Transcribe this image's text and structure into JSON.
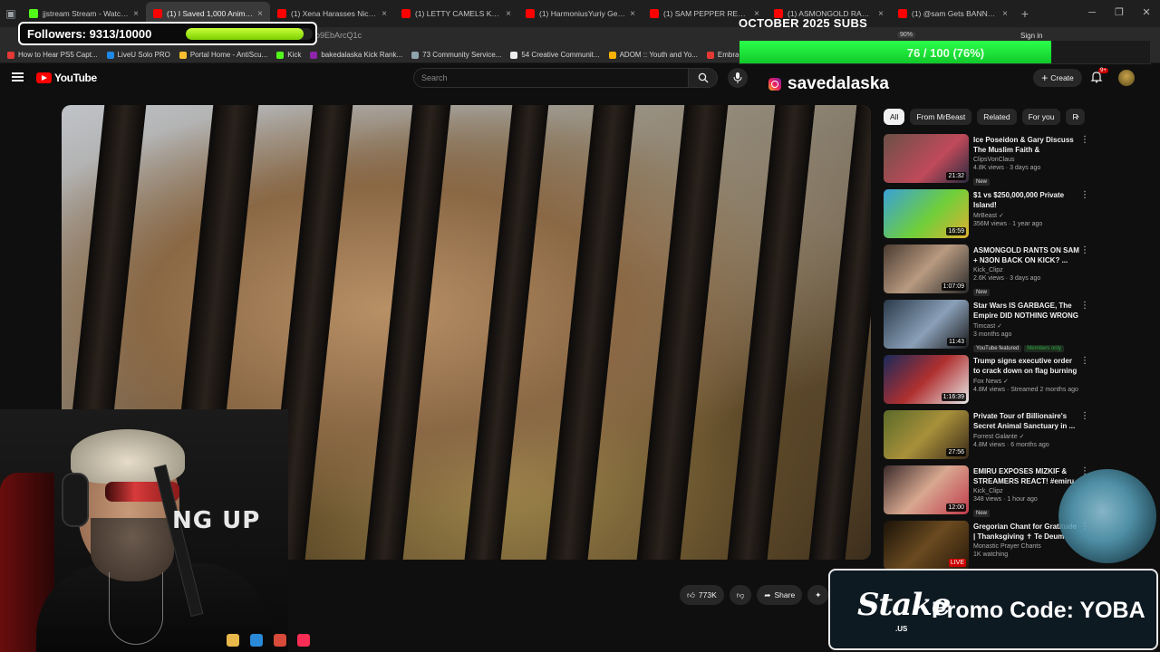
{
  "browser": {
    "tabs": [
      {
        "title": "jjstream Stream - Watch Live o",
        "color": "#53fc18",
        "active": false
      },
      {
        "title": "(1) I Saved 1,000 Animals",
        "color": "#ff0000",
        "active": true
      },
      {
        "title": "(1) Xena Harasses Nick Wi",
        "color": "#ff0000",
        "active": false
      },
      {
        "title": "(1) LETTY CAMELS KENYA WIT",
        "color": "#ff0000",
        "active": false
      },
      {
        "title": "(1) HarmoniusYuriy Gets A",
        "color": "#ff0000",
        "active": false
      },
      {
        "title": "(1) SAM PEPPER RETURNS",
        "color": "#ff0000",
        "active": false
      },
      {
        "title": "(1) ASMONGOLD RANTS",
        "color": "#ff0000",
        "active": false
      },
      {
        "title": "(1) @sam Gets BANNED on Ki",
        "color": "#ff0000",
        "active": false
      }
    ],
    "url_fragment": "o9EbArcQ1c",
    "zoom": "90%",
    "sign_in": "Sign in",
    "bookmarks": [
      {
        "label": "How to Hear PS5 Capt...",
        "color": "#e53935"
      },
      {
        "label": "LiveU Solo PRO",
        "color": "#1e88e5"
      },
      {
        "label": "Portal Home - AntiScu...",
        "color": "#fbc02d"
      },
      {
        "label": "Kick",
        "color": "#53fc18"
      },
      {
        "label": "bakedalaska Kick Rank...",
        "color": "#8e24aa"
      },
      {
        "label": "73 Community Service...",
        "color": "#90a4ae"
      },
      {
        "label": "54 Creative Communit...",
        "color": "#eeeeee"
      },
      {
        "label": "ADOM :: Youth and Yo...",
        "color": "#ffb300"
      },
      {
        "label": "Embracing the Cross a...",
        "color": "#e53935"
      }
    ]
  },
  "youtube": {
    "logo_text": "YouTube",
    "search_placeholder": "Search",
    "create_label": "Create",
    "notification_count": "9+",
    "video": {
      "overlay_caption": "NG UP"
    },
    "actions": {
      "likes": "773K",
      "share": "Share"
    },
    "chips": [
      "All",
      "From MrBeast",
      "Related",
      "For you",
      "R"
    ],
    "recommendations": [
      {
        "title": "Ice Poseidon & Gary Discuss The Muslim Faith & Immigration",
        "channel": "ClipsVonClaus",
        "meta": "4.8K views · 3 days ago",
        "badge": "New",
        "duration": "21:32",
        "thumb": "linear-gradient(135deg,#6b5046,#c04a5a 60%,#2a2a40)"
      },
      {
        "title": "$1 vs $250,000,000 Private Island!",
        "channel": "MrBeast ✓",
        "meta": "356M views · 1 year ago",
        "badge": "",
        "duration": "16:59",
        "thumb": "linear-gradient(135deg,#3aa0d8,#6fcf3a 55%,#e0b030)"
      },
      {
        "title": "ASMONGOLD RANTS ON SAM + N3ON BACK ON KICK? ...",
        "channel": "Kick_Clipz",
        "meta": "2.6K views · 3 days ago",
        "badge": "New",
        "duration": "1:07:09",
        "thumb": "linear-gradient(135deg,#4a3a30,#b89a80 50%,#2a2a2a)"
      },
      {
        "title": "Star Wars IS GARBAGE, The Empire DID NOTHING WRONG",
        "channel": "Timcast ✓",
        "meta": "3 months ago",
        "badge": "YouTube featured",
        "badge2": "Members only",
        "duration": "11:43",
        "thumb": "linear-gradient(135deg,#2a3a4a,#8aa0b8 55%,#1a1a1a)"
      },
      {
        "title": "Trump signs executive order to crack down on flag burning",
        "channel": "Fox News ✓",
        "meta": "4.8M views · Streamed 2 months ago",
        "badge": "",
        "duration": "1:16:39",
        "thumb": "linear-gradient(135deg,#1a2a5a,#b03030 50%,#e8e8e8)"
      },
      {
        "title": "Private Tour of Billionaire's Secret Animal Sanctuary in ...",
        "channel": "Forrest Galante ✓",
        "meta": "4.8M views · 6 months ago",
        "badge": "",
        "duration": "27:56",
        "thumb": "linear-gradient(135deg,#5a6a2a,#a8903a 50%,#3a2a1a)"
      },
      {
        "title": "EMIRU EXPOSES MIZKIF & STREAMERS REACT! #emiru ...",
        "channel": "Kick_Clipz",
        "meta": "348 views · 1 hour ago",
        "badge": "New",
        "duration": "12:00",
        "thumb": "linear-gradient(135deg,#3a2a2a,#d8a890 50%,#c03a4a)"
      },
      {
        "title": "Gregorian Chant for Gratitude | Thanksgiving ✝ Te Deum",
        "channel": "Monastic Prayer Chants",
        "meta": "1K watching",
        "badge": "",
        "duration": "LIVE",
        "thumb": "linear-gradient(135deg,#1a1208,#6a4a20 50%,#2a1a0a)"
      }
    ]
  },
  "overlays": {
    "followers_label": "Followers: 9313/10000",
    "followers_progress": 0.9313,
    "subs_title": "OCTOBER 2025 SUBS",
    "subs_text": "76 / 100 (76%)",
    "subs_progress": 0.76,
    "instagram_handle": "savedalaska",
    "promo_logo": "Stake",
    "promo_logo_sub": ".US",
    "promo_text": "Promo Code: YOBA"
  }
}
